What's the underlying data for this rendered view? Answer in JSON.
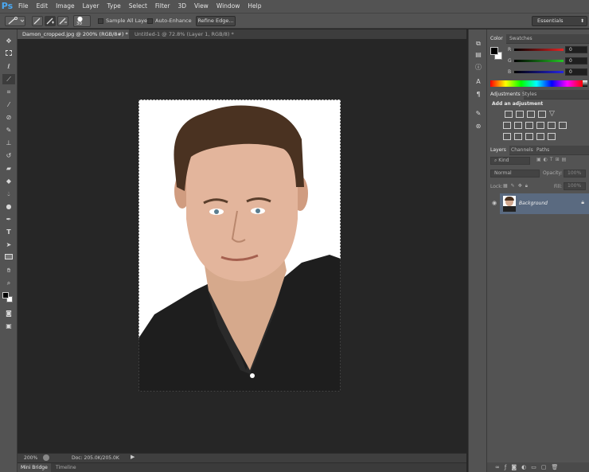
{
  "app": {
    "logo": "Ps"
  },
  "menu": [
    "File",
    "Edit",
    "Image",
    "Layer",
    "Type",
    "Select",
    "Filter",
    "3D",
    "View",
    "Window",
    "Help"
  ],
  "options_bar": {
    "brush_size": "30",
    "sample_all_layers": "Sample All Layers",
    "auto_enhance": "Auto-Enhance",
    "refine_edge": "Refine Edge...",
    "workspace": "Essentials"
  },
  "document_tabs": [
    {
      "label": "Damon_cropped.jpg @ 200% (RGB/8#) *",
      "active": true
    },
    {
      "label": "Untitled-1 @ 72.8% (Layer 1, RGB/8) *",
      "active": false
    }
  ],
  "status": {
    "zoom": "200%",
    "doc_size": "Doc: 205.0K/205.0K"
  },
  "bottom_tabs": [
    "Mini Bridge",
    "Timeline"
  ],
  "color_panel": {
    "tabs": [
      "Color",
      "Swatches"
    ],
    "channels": [
      {
        "label": "R",
        "value": "0",
        "color": "#d22b2b"
      },
      {
        "label": "G",
        "value": "0",
        "color": "#2bb32b"
      },
      {
        "label": "B",
        "value": "0",
        "color": "#2b2bd2"
      }
    ]
  },
  "adjustments_panel": {
    "tabs": [
      "Adjustments",
      "Styles"
    ],
    "heading": "Add an adjustment"
  },
  "layers_panel": {
    "tabs": [
      "Layers",
      "Channels",
      "Paths"
    ],
    "filter_kind": "Kind",
    "blend_mode": "Normal",
    "opacity_label": "Opacity:",
    "opacity_value": "100%",
    "lock_label": "Lock:",
    "fill_label": "Fill:",
    "fill_value": "100%",
    "layer_name": "Background"
  },
  "colors": {
    "accent_blue": "#4aa8f2",
    "selected_layer": "#5a6a80",
    "panel_bg": "#535353",
    "canvas_bg": "#262626"
  }
}
